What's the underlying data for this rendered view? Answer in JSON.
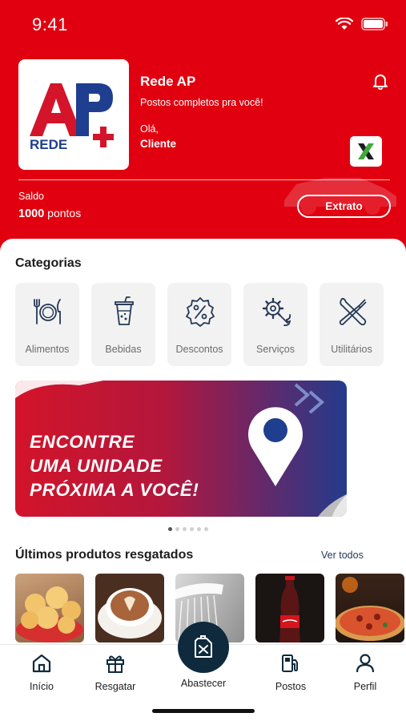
{
  "status_bar": {
    "time": "9:41"
  },
  "header": {
    "logo": {
      "letters": "AP",
      "plus": "+",
      "subtitle": "REDE"
    },
    "title": "Rede AP",
    "tagline": "Postos completos pra você!",
    "greeting": "Olá,",
    "user_name": "Cliente",
    "partner_badge": "X"
  },
  "balance": {
    "label": "Saldo",
    "points": "1000",
    "unit": "pontos",
    "statement_button": "Extrato"
  },
  "categories": {
    "title": "Categorias",
    "items": [
      {
        "label": "Alimentos",
        "icon": "cutlery-icon"
      },
      {
        "label": "Bebidas",
        "icon": "drink-cup-icon"
      },
      {
        "label": "Descontos",
        "icon": "discount-badge-icon"
      },
      {
        "label": "Serviços",
        "icon": "gear-wrench-icon"
      },
      {
        "label": "Utilitários",
        "icon": "tools-icon"
      }
    ]
  },
  "banner": {
    "lines": [
      "ENCONTRE",
      "UMA UNIDADE",
      "PRÓXIMA A VOCÊ!"
    ],
    "icon": "map-pin-icon",
    "slide_count": 6,
    "active_slide": 1
  },
  "products": {
    "title": "Últimos produtos resgatados",
    "see_all": "Ver todos",
    "items": [
      {
        "name": "pao-de-queijo"
      },
      {
        "name": "cafe"
      },
      {
        "name": "chuveiro"
      },
      {
        "name": "coca-cola"
      },
      {
        "name": "pizza"
      }
    ]
  },
  "bottom_nav": {
    "items": [
      {
        "label": "Início",
        "icon": "home-icon"
      },
      {
        "label": "Resgatar",
        "icon": "gift-icon"
      },
      {
        "label": "Abastecer",
        "icon": "fuel-can-icon"
      },
      {
        "label": "Postos",
        "icon": "fuel-pump-icon"
      },
      {
        "label": "Perfil",
        "icon": "user-icon"
      }
    ]
  },
  "colors": {
    "brand_red": "#e1000f",
    "brand_navy": "#0f2a3d",
    "logo_blue": "#1f3e8f"
  }
}
